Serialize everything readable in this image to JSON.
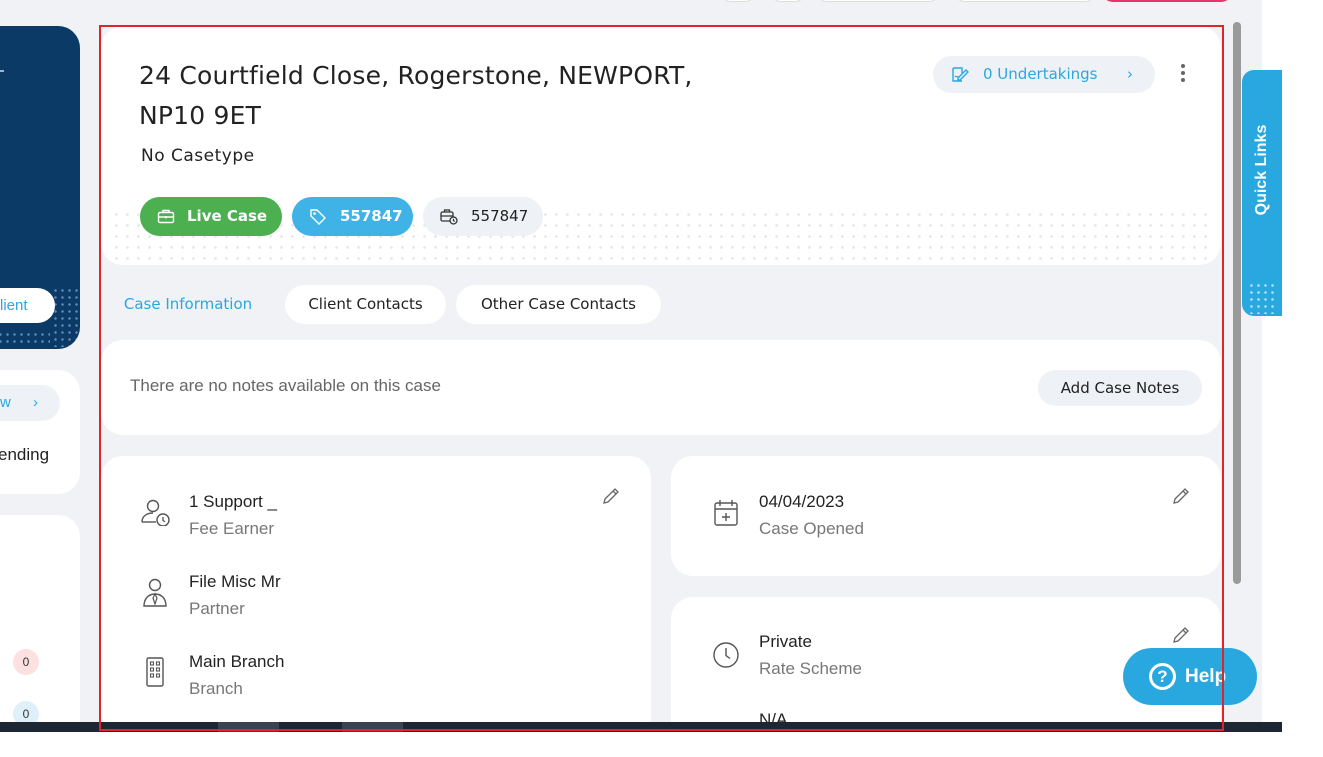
{
  "left_panel": {
    "client_label": "lient",
    "view_label": "w",
    "pending_label": "ending",
    "count_red": "0",
    "count_blue": "0"
  },
  "case": {
    "address_line1": "24 Courtfield Close, Rogerstone, NEWPORT,",
    "address_line2": "NP10 9ET",
    "casetype": "No Casetype",
    "undertakings_label": "0 Undertakings",
    "status_label": "Live Case",
    "tag_number": "557847",
    "reference_number": "557847"
  },
  "tabs": [
    {
      "label": "Case Information",
      "active": true
    },
    {
      "label": "Client Contacts",
      "active": false
    },
    {
      "label": "Other Case Contacts",
      "active": false
    }
  ],
  "notes": {
    "empty_text": "There are no notes available on this case",
    "add_button": "Add Case Notes"
  },
  "details_left": [
    {
      "value": "1 Support _",
      "label": "Fee Earner",
      "icon": "user-clock-icon"
    },
    {
      "value": "File Misc Mr",
      "label": "Partner",
      "icon": "user-tie-icon"
    },
    {
      "value": "Main Branch",
      "label": "Branch",
      "icon": "building-icon"
    }
  ],
  "details_right": [
    {
      "value": "04/04/2023",
      "label": "Case Opened",
      "icon": "calendar-plus-icon"
    },
    {
      "value": "Private",
      "label": "Rate Scheme",
      "icon": "clock-icon"
    },
    {
      "value": "N/A",
      "label": "",
      "icon": ""
    }
  ],
  "quick_links_label": "Quick Links",
  "help_label": "Help",
  "colors": {
    "accent": "#29a8e0",
    "live_green": "#4caf50",
    "navy": "#0b3a67",
    "highlight_red": "#e0242a"
  }
}
